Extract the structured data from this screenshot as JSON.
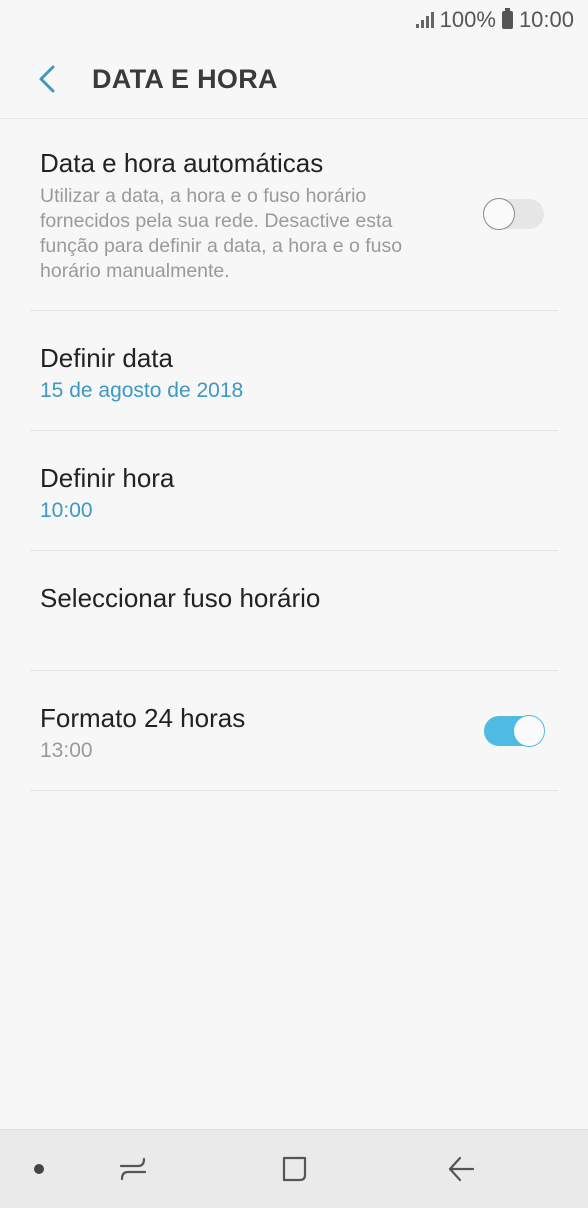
{
  "status_bar": {
    "battery": "100%",
    "time": "10:00"
  },
  "header": {
    "title": "DATA E HORA"
  },
  "settings": {
    "auto": {
      "title": "Data e hora automáticas",
      "description": "Utilizar a data, a hora e o fuso horário fornecidos pela sua rede. Desactive esta função para definir a data, a hora e o fuso horário manualmente.",
      "enabled": false
    },
    "date": {
      "title": "Definir data",
      "value": "15 de agosto de 2018"
    },
    "time": {
      "title": "Definir hora",
      "value": "10:00"
    },
    "timezone": {
      "title": "Seleccionar fuso horário"
    },
    "format24": {
      "title": "Formato 24 horas",
      "value": "13:00",
      "enabled": true
    }
  },
  "colors": {
    "accent": "#3e98c3",
    "toggle_on": "#4fbbe3"
  },
  "nav": {
    "icons": [
      "dot-icon",
      "recent-apps-icon",
      "home-icon",
      "back-icon"
    ]
  }
}
